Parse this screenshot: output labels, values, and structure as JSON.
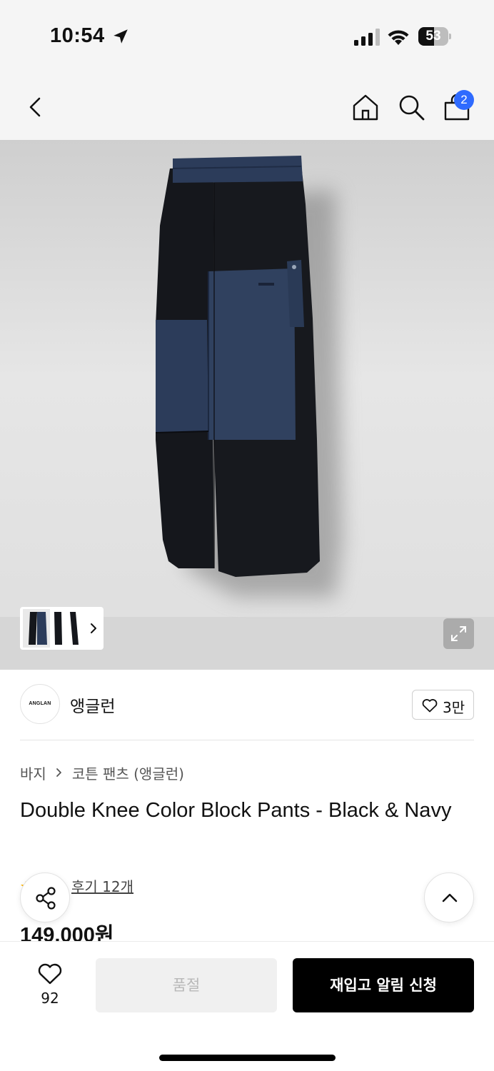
{
  "status_bar": {
    "time": "10:54",
    "battery": "53",
    "battery_level": 0.53,
    "signal_bars": 3,
    "icons": [
      "location-arrow-icon",
      "cellular-signal-icon",
      "wifi-icon",
      "battery-icon"
    ]
  },
  "nav": {
    "cart_count": "2",
    "icons": [
      "back-chevron-icon",
      "home-icon",
      "search-icon",
      "shopping-bag-icon"
    ],
    "badge_color": "#2f6bff"
  },
  "gallery": {
    "icons": [
      "chevron-right-icon",
      "expand-icon"
    ]
  },
  "brand": {
    "logo_text": "ANGLAN",
    "name": "앵글런",
    "likes": "3만"
  },
  "breadcrumb": {
    "category": "바지",
    "subcategory": "코튼 팬츠 (앵글런)"
  },
  "product": {
    "title": "Double Knee Color Block Pants - Black & Navy",
    "review_link": "후기 12개",
    "price": "149,000원"
  },
  "bottom_bar": {
    "wishlist_count": "92",
    "soldout_label": "품절",
    "restock_label": "재입고 알림 신청"
  },
  "colors": {
    "accent": "#2f6bff",
    "primary_button": "#000000",
    "disabled_button": "#f0f0f0",
    "pants_black": "#15171c",
    "pants_navy": "#2c3c5a"
  }
}
